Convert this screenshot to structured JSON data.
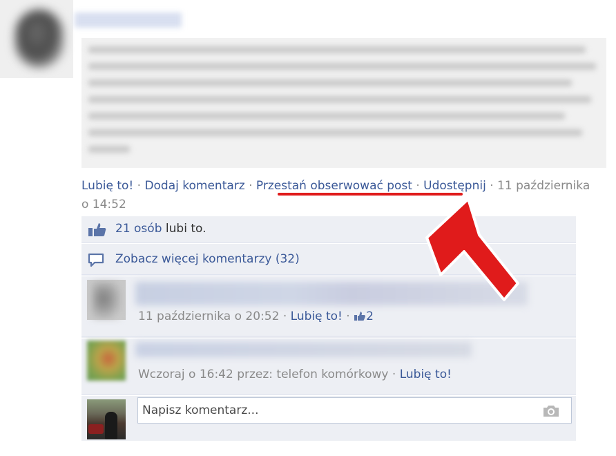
{
  "post": {
    "actions": {
      "like": "Lubię to!",
      "comment": "Dodaj komentarz",
      "unfollow": "Przestań obserwować post",
      "share": "Udostępnij",
      "separator": "·",
      "timestamp": "11 października o 14:52"
    }
  },
  "ufi": {
    "likes": {
      "count": "21 osób",
      "suffix": "lubi to."
    },
    "more_comments": "Zobacz więcej komentarzy (32)",
    "comments": [
      {
        "timestamp": "11 października o 20:52",
        "like": "Lubię to!",
        "like_count": "2"
      },
      {
        "timestamp": "Wczoraj o 16:42 przez: telefon komórkowy",
        "like": "Lubię to!"
      }
    ],
    "composer": {
      "placeholder": "Napisz komentarz..."
    }
  },
  "colors": {
    "link": "#3b5998",
    "meta_text": "#8a8a8a",
    "panel_background": "#edeff4",
    "annotation_red": "#e01b1b"
  },
  "icons": [
    "like-thumb-icon",
    "comment-bubble-icon",
    "camera-icon",
    "annotation-arrow-icon"
  ]
}
